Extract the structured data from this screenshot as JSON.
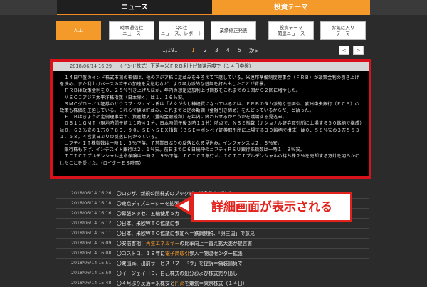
{
  "topbar": {
    "tabs": [
      {
        "label": "ニュース"
      },
      {
        "label": "投資テーマ"
      }
    ]
  },
  "categories": [
    {
      "label": "ALL"
    },
    {
      "label": "時事通信社\nニュース"
    },
    {
      "label": "QC社\nニュース、レポート"
    },
    {
      "label": "業績修正発表"
    },
    {
      "label": "投資テーマ\n関連ニュース"
    },
    {
      "label": "お気に入り\nテーマ"
    }
  ],
  "pager": {
    "count": "1/191",
    "pages": [
      "1",
      "2",
      "3",
      "4",
      "5",
      "次>"
    ],
    "prev": "<",
    "next": ">"
  },
  "detail": {
    "time": "2018/06/14 16:29",
    "headline": "〈インド株式〉下落＝米ＦＲＢ利上げ加速示唆で（１４日中盤）",
    "paragraphs": [
      "　１４日中盤のインド株式市場の株価は、他のアジア株に足並みをそろえて下落している。米連邦準備制度理事会（ＦＲＢ）が政策金利の引き上げを決め、また利上げペースの若干の加速を見込むなど、より早力派的な基調を打ち出したことが背景。",
      "　ＦＲＢは政策金利を０．２５％引き上げたほか、年内の想定追加利上げ回数をこれまでの１回から２回に増やした。",
      "　ＭＳＣＩアジア太平洋株指数（日本除く）は１．１６％安。",
      "　ＳＭＣグローバル証券のサウラブ・ジェイン氏は「人々が少し神経質になっているのは、ＦＲＢのタカ派的な基調や、欧州中央銀行（ＥＣＢ）の政策も株価を圧迫している。これらで値は軒並み、これまでと逆の動調（金融引き締め）をたどっているからだ」と語った。",
      "　ＥＣＢはきょうの定例理事会で、資産購入（量的金融緩和）を年内に終わらせるかどうかを議論する見込み。",
      "　０６１１ＧＭＴ（現地時間午前１１時４１分、日本時間午後３時１１分）時点で、ＮＳＥ指数（ナショナル証券取引所に上場する５０銘柄で構成）は０．６２％安の１万０７８９．９０、ＳＥＮＳＥＸ指数（ＢＳＥ＝ボンベイ証券取引所に上場する３０銘柄で構成）は０．５８％安の３万５５３１．５８。４営業日ぶりの反落に向かっている。",
      "　ニフティＩＴ株指数は一時１．５％下落。７営業日ぶりの反落となる見込み。インフォシスは２．６％安。",
      "　銀行株も下げ、インデスイト銀行は２．１％安。前日までに６日続伸のニフティＰＳＵ銀行株指数は一時１．９％安。",
      "　ＩＣＩＣＩプルデンシャル生命保険は一時２．９％下落。ＩＣＩＣＩ銀行が、ＩＣＩＣＩプルデンシャルの持ち株２％を売却する方針を明らかにしたことを受けた。（ロイターＥＳ時事）"
    ]
  },
  "news_rows": [
    {
      "time": "2018/06/14 16:29",
      "headline": ""
    },
    {
      "time": "2018/06/14 16:26",
      "headline": "〇ロジザ、新規公開株式のブックビル仮条件など決定"
    },
    {
      "time": "2018/06/14 16:18",
      "headline": "〇東京ディズニーシーを拡張"
    },
    {
      "time": "2018/06/14 16:16",
      "headline": "〇幕張メッセ、五輪使用５カ"
    },
    {
      "time": "2018/06/14 16:12",
      "headline": "〇日本、米欧ＷＴＯ協議に参"
    },
    {
      "time": "2018/06/14 16:11",
      "headline": "〇日本、米欧ＷＴＯ協議に参加へ＝鉄鋼関税、「第三国」で意見"
    },
    {
      "time": "2018/06/14 16:09",
      "headline_pre": "〇安倍首相：",
      "headline_hl": "再生エネルギー",
      "headline_post": "の比率向上＝首え拡大委が提言書"
    },
    {
      "time": "2018/06/14 16:08",
      "headline_pre": "〇コストコ、１９年に",
      "headline_hl": "電子商取引",
      "headline_post": "参入＝物流センター拡張"
    },
    {
      "time": "2018/06/14 15:51",
      "headline": "〇東出局、出前サービス「フードラ」を提訴＝偽装請負で"
    },
    {
      "time": "2018/06/14 15:50",
      "headline": "〇イージェイＨＤ、自己株式の処分および株式売り出し"
    },
    {
      "time": "2018/06/14 15:48",
      "headline_pre": "〇４月ぶり反落＝米株安と",
      "headline_hl": "円高",
      "headline_post": "を嫌気＝東京株式（１４日）"
    }
  ],
  "callout": {
    "text": "詳細画面が表示される"
  },
  "colors": {
    "accent": "#f39a2b",
    "highlight_border": "#d8111b",
    "background": "#2b2b2b"
  }
}
